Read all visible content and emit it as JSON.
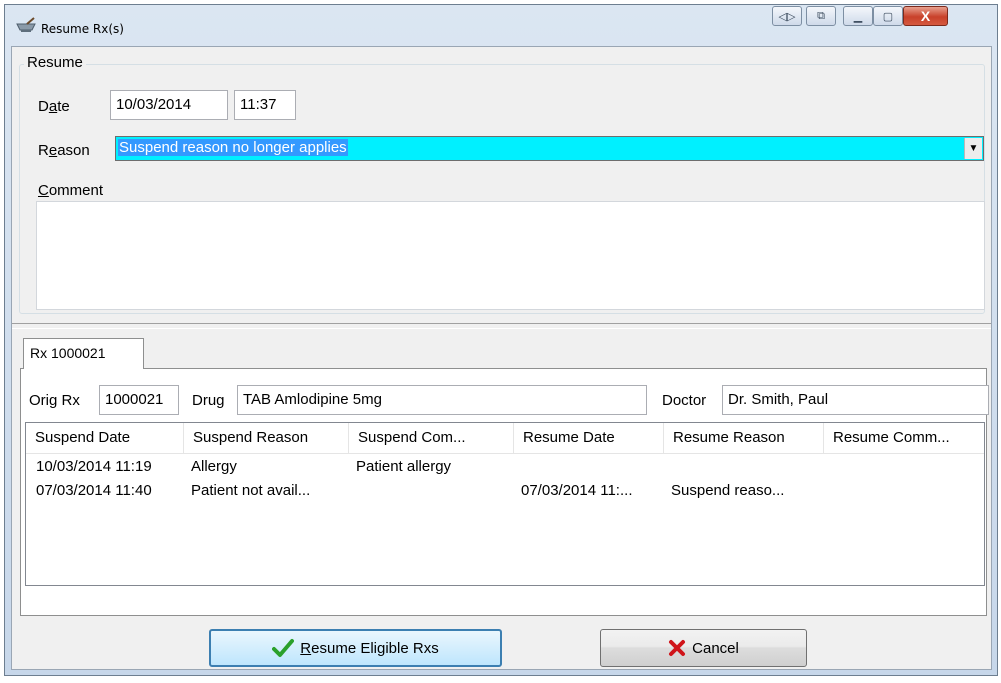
{
  "window": {
    "title": "Resume Rx(s)",
    "close_glyph": "X",
    "min_glyph": "▁",
    "max_glyph": "▢",
    "extra1_glyph": "◁▷",
    "extra2_glyph": "⧉"
  },
  "resume_group": {
    "legend": "Resume",
    "date_label_pre": "D",
    "date_label_u": "a",
    "date_label_post": "te",
    "date_value": "10/03/2014",
    "time_value": "11:37",
    "reason_label_pre": "R",
    "reason_label_u": "e",
    "reason_label_post": "ason",
    "reason_value": "Suspend reason no longer applies",
    "comment_label_pre": "",
    "comment_label_u": "C",
    "comment_label_post": "omment",
    "comment_value": ""
  },
  "tab": {
    "label": "Rx 1000021"
  },
  "rx_info": {
    "orig_rx_label": "Orig Rx",
    "orig_rx_value": "1000021",
    "drug_label": "Drug",
    "drug_value": "TAB Amlodipine 5mg",
    "doctor_label": "Doctor",
    "doctor_value": "Dr. Smith, Paul"
  },
  "history": {
    "columns": [
      "Suspend Date",
      "Suspend Reason",
      "Suspend Com...",
      "Resume Date",
      "Resume Reason",
      "Resume Comm..."
    ],
    "rows": [
      [
        "10/03/2014 11:19",
        "Allergy",
        "Patient allergy",
        "",
        "",
        ""
      ],
      [
        "07/03/2014 11:40",
        "Patient not avail...",
        "",
        "07/03/2014 11:...",
        "Suspend reaso...",
        ""
      ]
    ]
  },
  "buttons": {
    "resume_pre": "",
    "resume_u": "R",
    "resume_post": "esume Eligible Rxs",
    "cancel_label": "Cancel"
  },
  "colors": {
    "reason_bg": "#00f0ff",
    "selection": "#3399ff",
    "check_green": "#2ba02b",
    "cancel_red": "#d0141a"
  },
  "icons": [
    "mortar-pestle-icon",
    "checkmark-icon",
    "cancel-x-icon",
    "dropdown-arrow-icon"
  ]
}
